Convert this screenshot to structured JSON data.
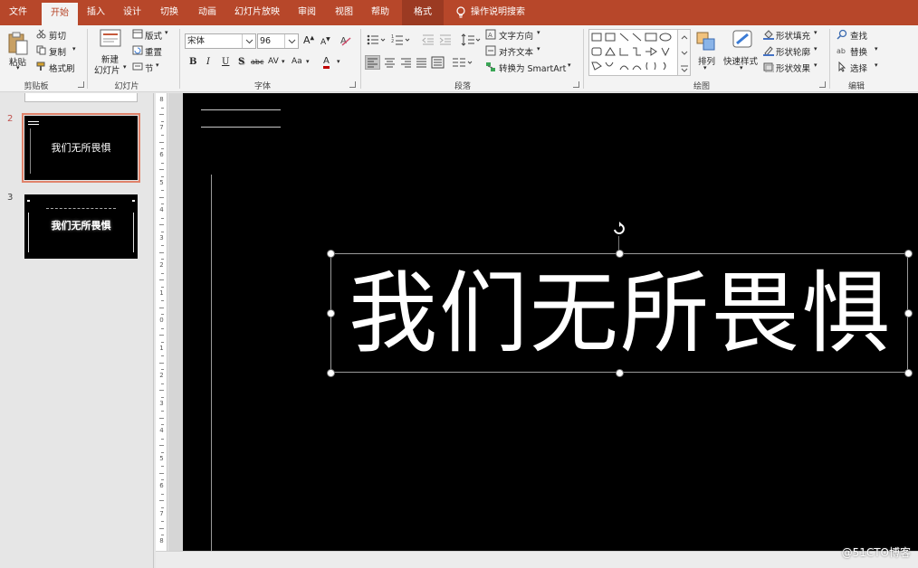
{
  "tabs": {
    "file": "文件",
    "home": "开始",
    "insert": "插入",
    "design": "设计",
    "transitions": "切换",
    "animations": "动画",
    "slideshow": "幻灯片放映",
    "review": "审阅",
    "view": "视图",
    "help": "帮助",
    "format": "格式",
    "tell_me": "操作说明搜索"
  },
  "clipboard": {
    "paste": "粘贴",
    "cut": "剪切",
    "copy": "复制",
    "format_painter": "格式刷",
    "label": "剪贴板"
  },
  "slides_group": {
    "new_slide_line1": "新建",
    "new_slide_line2": "幻灯片",
    "layout": "版式",
    "reset": "重置",
    "section": "节",
    "label": "幻灯片"
  },
  "font": {
    "name": "宋体",
    "size": "96",
    "bold": "B",
    "italic": "I",
    "underline": "U",
    "shadow": "S",
    "strike": "abc",
    "spacing": "AV",
    "case": "Aa",
    "color": "A",
    "grow": "A",
    "shrink": "A",
    "label": "字体"
  },
  "paragraph": {
    "text_direction": "文字方向",
    "align_text": "对齐文本",
    "smartart": "转换为 SmartArt",
    "label": "段落"
  },
  "drawing": {
    "arrange": "排列",
    "quick_styles": "快速样式",
    "shape_fill": "形状填充",
    "shape_outline": "形状轮廓",
    "shape_effects": "形状效果",
    "label": "绘图"
  },
  "editing": {
    "find": "查找",
    "replace": "替换",
    "select": "选择",
    "label": "编辑"
  },
  "thumbnails": [
    {
      "number": "2",
      "title": "我们无所畏惧"
    },
    {
      "number": "3",
      "title": "我们无所畏惧"
    }
  ],
  "vruler_ticks": [
    "8",
    "7",
    "6",
    "5",
    "4",
    "3",
    "2",
    "1",
    "0",
    "1",
    "2",
    "3",
    "4",
    "5",
    "6",
    "7",
    "8"
  ],
  "slide": {
    "title": "我们无所畏惧"
  },
  "watermark": "@51CTO博客",
  "colors": {
    "accent": "#b7472a",
    "selected_thumb_border": "#e0836b",
    "slide_bg": "#000000"
  }
}
